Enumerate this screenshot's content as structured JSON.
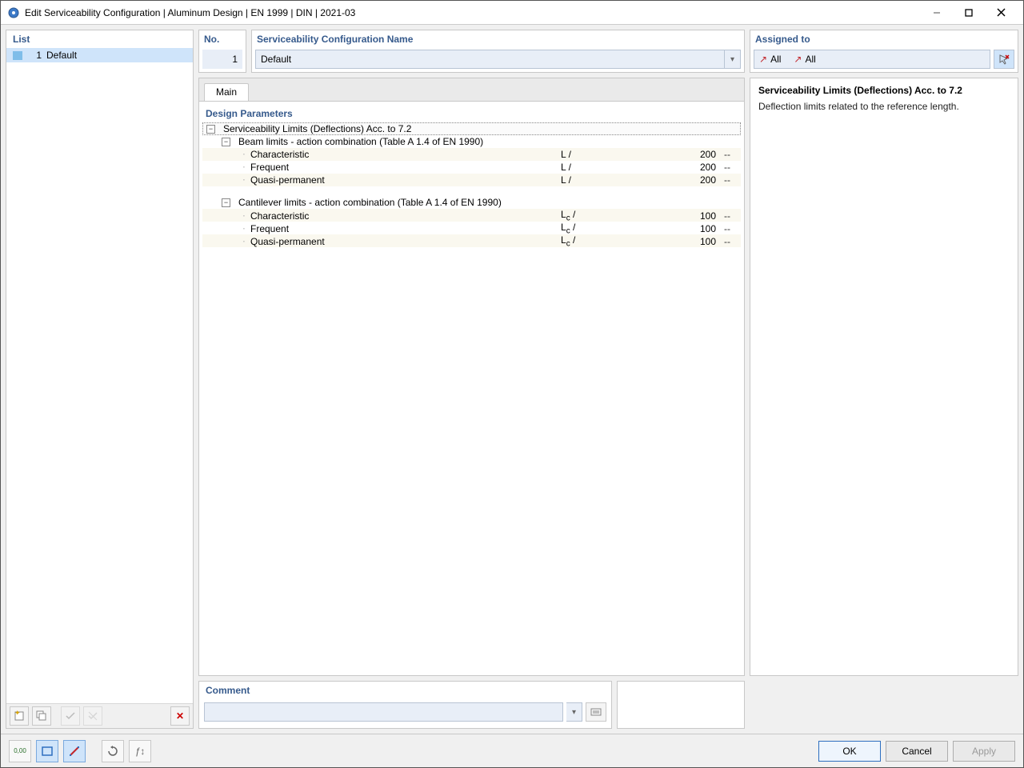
{
  "window": {
    "title": "Edit Serviceability Configuration | Aluminum Design | EN 1999 | DIN | 2021-03"
  },
  "list_panel": {
    "heading": "List",
    "items": [
      {
        "no": "1",
        "label": "Default"
      }
    ]
  },
  "header": {
    "no_label": "No.",
    "no_value": "1",
    "name_label": "Serviceability Configuration Name",
    "name_value": "Default",
    "assigned_label": "Assigned to",
    "assigned_values": [
      "All",
      "All"
    ]
  },
  "tabs": {
    "main": "Main"
  },
  "tree": {
    "section_title": "Design Parameters",
    "root_label": "Serviceability Limits (Deflections) Acc. to 7.2",
    "groups": [
      {
        "label": "Beam limits - action combination (Table A 1.4 of EN 1990)",
        "sym_html": "L /",
        "rows": [
          {
            "label": "Characteristic",
            "value": "200",
            "unit": "--"
          },
          {
            "label": "Frequent",
            "value": "200",
            "unit": "--"
          },
          {
            "label": "Quasi-permanent",
            "value": "200",
            "unit": "--"
          }
        ]
      },
      {
        "label": "Cantilever limits - action combination (Table A 1.4 of EN 1990)",
        "sym_html": "L<sub>c</sub> /",
        "rows": [
          {
            "label": "Characteristic",
            "value": "100",
            "unit": "--"
          },
          {
            "label": "Frequent",
            "value": "100",
            "unit": "--"
          },
          {
            "label": "Quasi-permanent",
            "value": "100",
            "unit": "--"
          }
        ]
      }
    ]
  },
  "help": {
    "title": "Serviceability Limits (Deflections) Acc. to 7.2",
    "body": "Deflection limits related to the reference length."
  },
  "comment": {
    "label": "Comment",
    "value": ""
  },
  "buttons": {
    "ok": "OK",
    "cancel": "Cancel",
    "apply": "Apply"
  }
}
